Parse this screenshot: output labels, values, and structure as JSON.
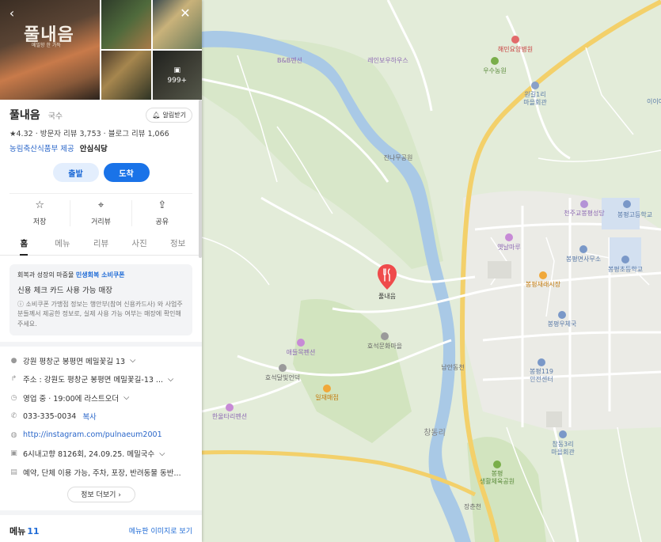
{
  "place": {
    "name": "풀내음",
    "category": "국수",
    "notify_label": "알림받기",
    "photo_logo": "풀내음",
    "photo_logo_sub": "메밀향 한 가득",
    "photo_count": "999+",
    "rating_line": "★4.32 · 방문자 리뷰 3,753 · 블로그 리뷰 1,066",
    "tag_source": "농림축산식품부 제공",
    "tag_badge": "안심식당"
  },
  "route": {
    "start_label": "출발",
    "dest_label": "도착"
  },
  "actions": [
    {
      "label": "저장",
      "icon": "star-outline-icon",
      "glyph": "☆"
    },
    {
      "label": "거리뷰",
      "icon": "location-pin-icon",
      "glyph": "⌖"
    },
    {
      "label": "공유",
      "icon": "share-icon",
      "glyph": "⇪"
    }
  ],
  "tabs": [
    "홈",
    "메뉴",
    "리뷰",
    "사진",
    "정보"
  ],
  "coupon": {
    "line1_prefix": "회복과 성장의 마중물 ",
    "line1_highlight": "민생회복 소비쿠폰",
    "line2": "신용 체크 카드 사용 가능 매장",
    "note": "ⓘ 소비쿠폰 가맹점 정보는 행안부(참여 신용카드사) 와 사업주분들께서 제공한 정보로, 실제 사용 가능 여부는 매장에 확인해 주세요."
  },
  "details": {
    "address": "강원 평창군 봉평면 메밀꽃길 13",
    "road_address": "주소 : 강원도 평창군 봉평면 메밀꽃길-13 ...",
    "hours": "영업 중 · 19:00에 라스트오더",
    "phone": "033-335-0034",
    "copy_label": "복사",
    "website": "http://instagram.com/pulnaeum2001",
    "tv": "6시내고향 8126회, 24.09.25. 메밀국수",
    "services": "예약, 단체 이용 가능, 주차, 포장, 반려동물 동반...",
    "more_label": "정보 더보기 ›"
  },
  "menu": {
    "title": "메뉴",
    "count": "11",
    "link": "메뉴판 이미지로 보기"
  },
  "map": {
    "labels": {
      "bnb": "B&B펜션",
      "rainbow": "레인보우하우스",
      "hospital": "해민요양병원",
      "farm": "우수농원",
      "village1": "원길1리",
      "village1b": "마을회관",
      "edge": "이이어",
      "stream_park": "잔나무공원",
      "church": "천주교봉평성당",
      "school_high": "봉평고등학교",
      "office": "봉평면사무소",
      "school_elem": "봉평초등학교",
      "meadow": "옛날마루",
      "market": "봉평재래시장",
      "target": "풀내음",
      "post": "봉평우체국",
      "fire": "봉평119",
      "fire2": "안전센터",
      "cultural": "효석문화마을",
      "cafe": "애들목펜션",
      "house": "효석달빛언덕",
      "ilje": "일재매점",
      "sample": "남안동천",
      "hotel": "한울타리펜션",
      "nature": "창동리",
      "village3": "창동3리",
      "village3b": "마을회관",
      "sports": "봉평",
      "sports2": "생활체육공원",
      "stream": "장춘천"
    }
  },
  "colors": {
    "accent": "#1a73e8",
    "pin": "#ef4b4b",
    "road": "#f9d56b"
  }
}
